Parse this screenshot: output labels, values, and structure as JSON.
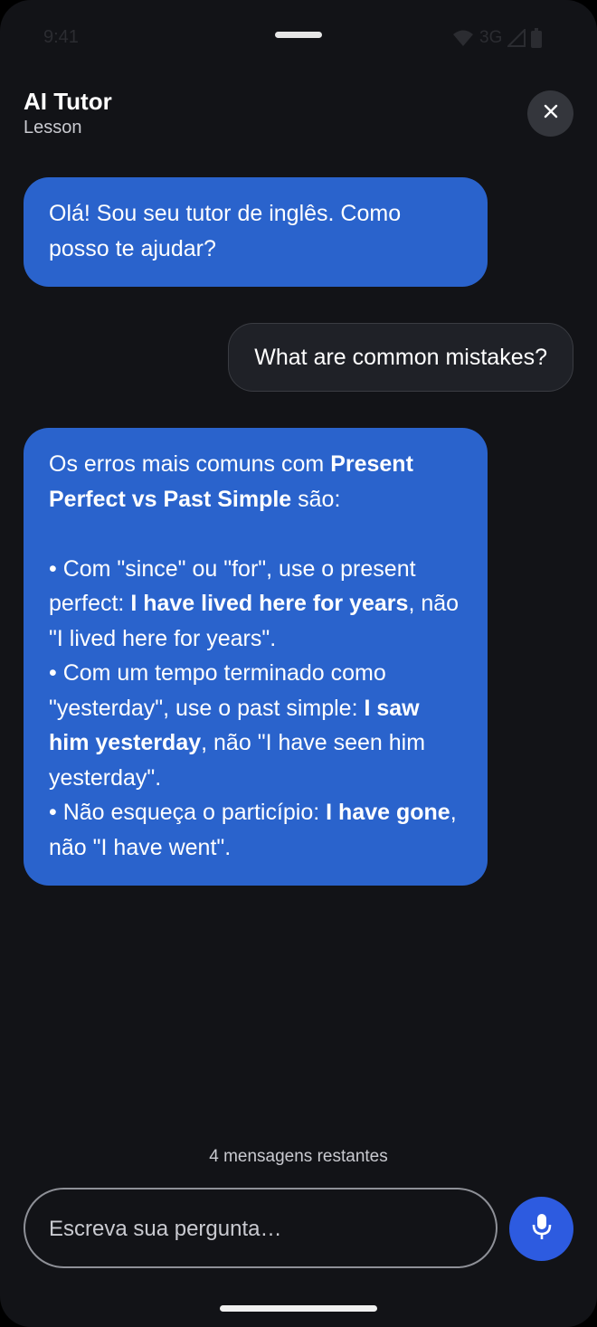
{
  "status_bar": {
    "time": "9:41",
    "network": "3G"
  },
  "header": {
    "title": "AI Tutor",
    "subtitle": "Lesson"
  },
  "messages": [
    {
      "role": "tutor",
      "text": "Olá! Sou seu tutor de inglês. Como posso te ajudar?"
    },
    {
      "role": "user",
      "text": "What are common mistakes?"
    },
    {
      "role": "tutor",
      "intro": "Os erros mais comuns com ",
      "intro_bold": "Present Perfect vs Past Simple",
      "intro_end": " são:",
      "points": [
        {
          "pre": "• Com \"since\" ou \"for\", use o present perfect: ",
          "bold": "I have lived here for years",
          "post": ", não \"I lived here for years\"."
        },
        {
          "pre": "• Com um tempo terminado como \"yesterday\", use o past simple: ",
          "bold": "I saw him yesterday",
          "post": ", não \"I have seen him yesterday\"."
        },
        {
          "pre": "• Não esqueça o particípio: ",
          "bold": "I have gone",
          "post": ", não \"I have went\"."
        }
      ]
    }
  ],
  "footer": {
    "remaining": "4 mensagens restantes",
    "input_placeholder": "Escreva sua pergunta…"
  },
  "icons": {
    "close": "close-icon",
    "mic": "microphone-icon",
    "wifi": "wifi-icon",
    "signal": "signal-icon",
    "battery": "battery-icon"
  },
  "colors": {
    "tutor_bubble": "#2a63cc",
    "mic_button": "#2d5be0",
    "background": "#121317"
  }
}
